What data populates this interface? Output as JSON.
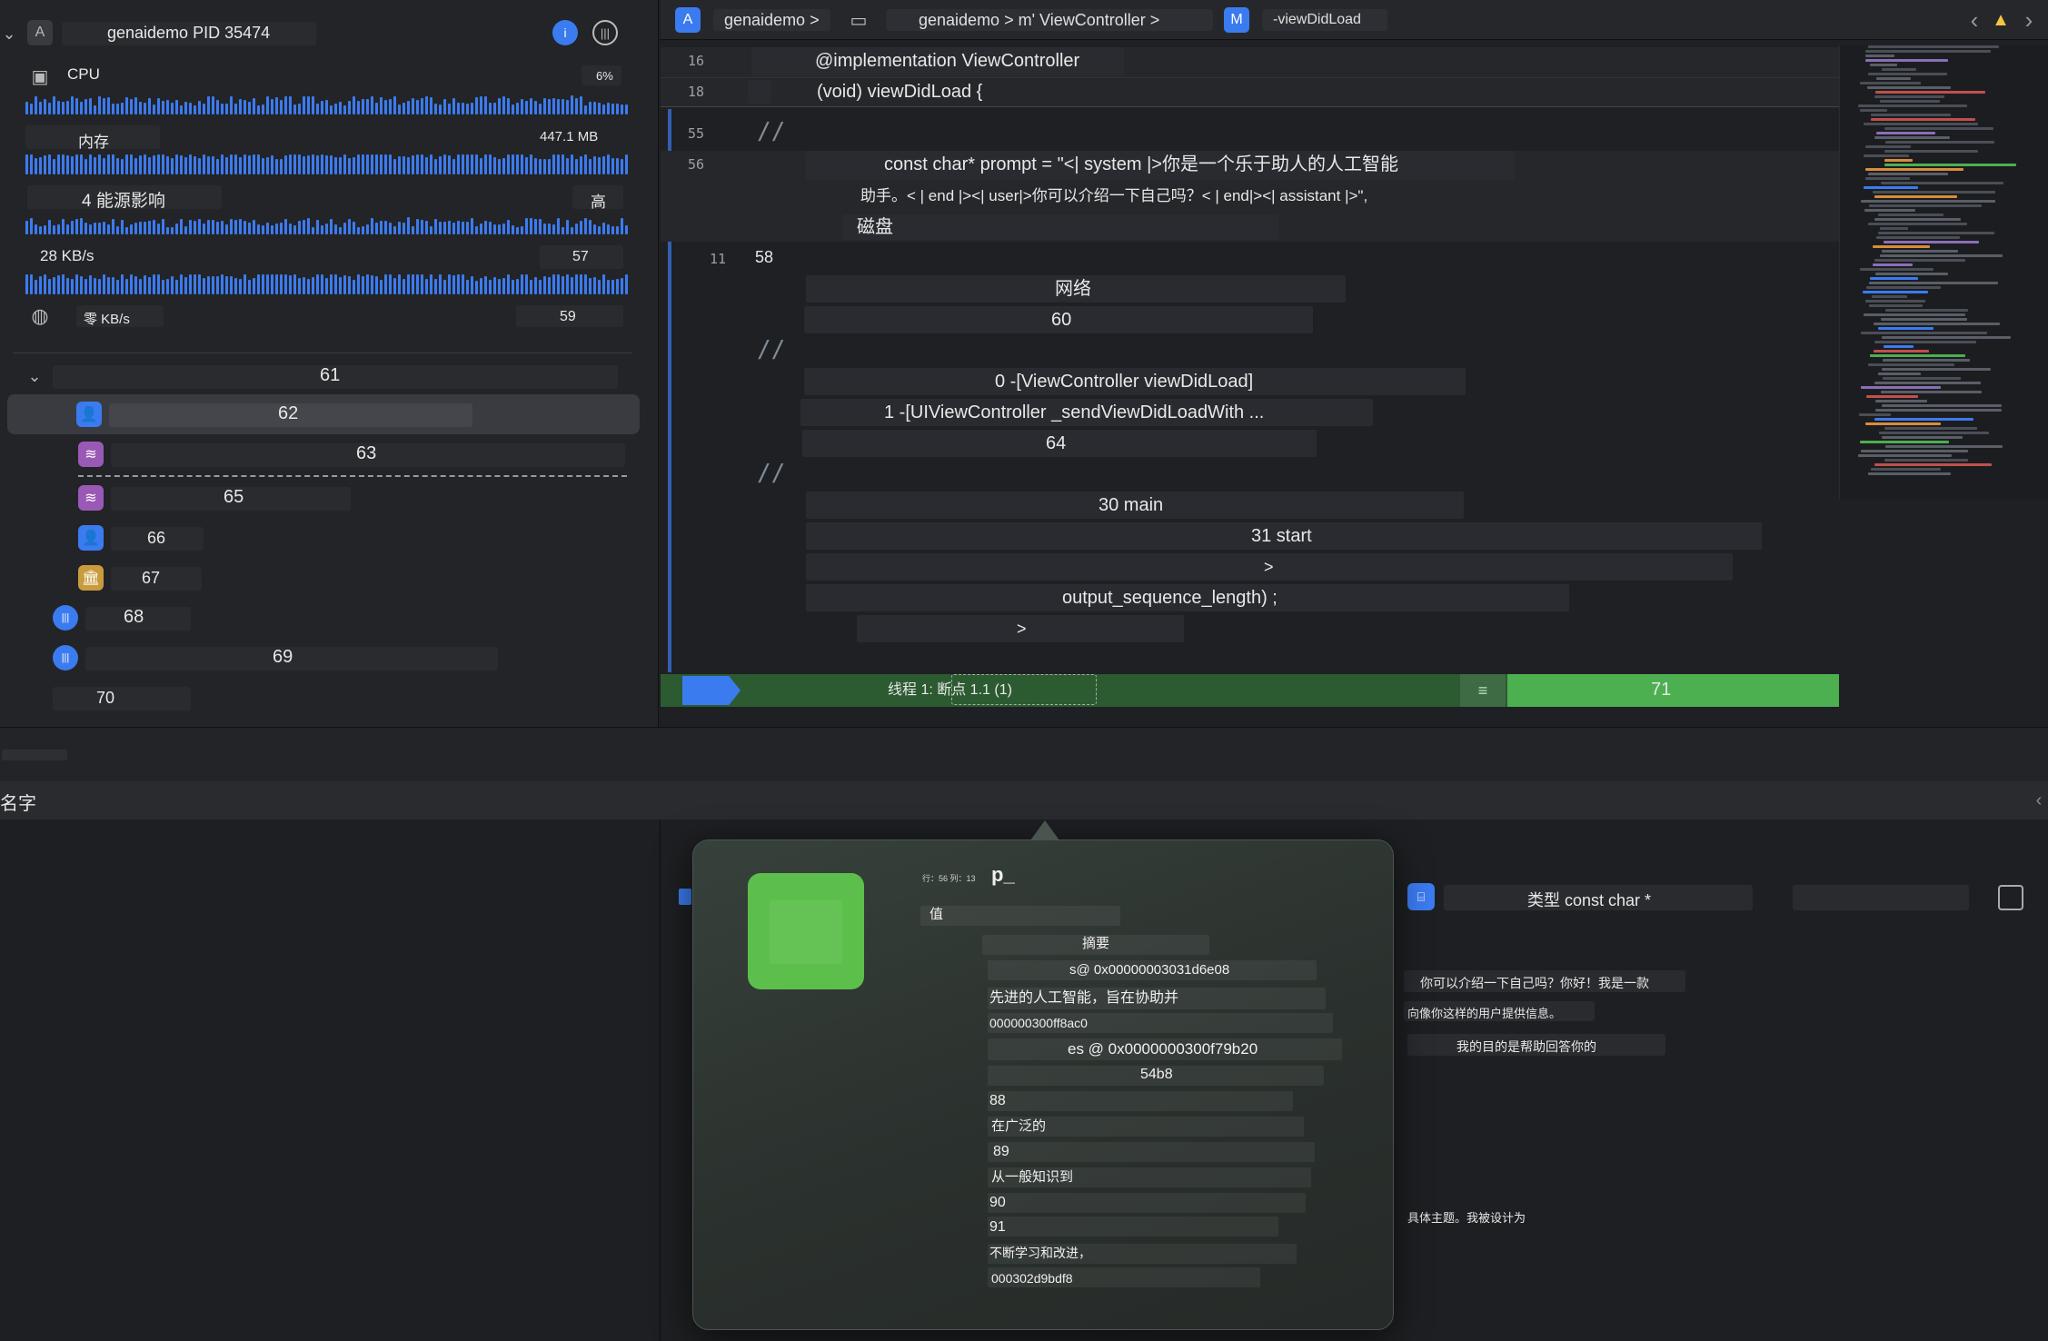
{
  "process": {
    "title": "genaidemo PID 35474"
  },
  "gauges": {
    "cpu_label": "CPU",
    "cpu_value": "6%",
    "memory_label": "内存",
    "memory_value": "447.1 MB",
    "energy_label": "4 能源影响",
    "energy_value": "高",
    "disk_value": "28 KB/s",
    "disk_side": "57",
    "network_value": "零 KB/s",
    "network_side": "59"
  },
  "threads": [
    {
      "label": "61"
    },
    {
      "label": "62"
    },
    {
      "label": "63"
    },
    {
      "label": "65"
    },
    {
      "label": "66"
    },
    {
      "label": "67"
    },
    {
      "label": "68"
    },
    {
      "label": "69"
    },
    {
      "label": "70"
    }
  ],
  "jumpbar": {
    "project": "genaidemo >",
    "path": "genaidemo > m' ViewController >",
    "method_badge": "M",
    "method": "-viewDidLoad"
  },
  "code": {
    "line16_no": "16",
    "line16": "@implementation ViewController",
    "line18_no": "18",
    "line18": "(void) viewDidLoad {",
    "line55_no": "55",
    "line56_no": "56",
    "prompt_a": "const char* prompt = \"<| system |>你是一个乐于助人的人工智能",
    "prompt_b": "助手。< | end |><| user|>你可以介绍一下自己吗？< | end|><| assistant |>\",",
    "disk": "磁盘",
    "line11_no": "11",
    "line58_no": "58",
    "network": "网络",
    "n60": "60",
    "frame0": "0 -[ViewController viewDidLoad]",
    "frame1": "1 -[UIViewController _sendViewDidLoadWith ...",
    "n64": "64",
    "frame30": "30 main",
    "frame31": "31 start",
    "gt1": ">",
    "output_len": "output_sequence_length) ;",
    "gt2": ">",
    "comment": "//"
  },
  "breakpoint": {
    "label": "线程 1: 断点 1.1 (1)",
    "count": "71"
  },
  "debug": {
    "filter_label": "名字"
  },
  "popover": {
    "var_name": "p_",
    "pos": "行：56 列：13",
    "value_label": "值",
    "summary_label": "摘要",
    "r1": "s@ 0x00000003031d6e08",
    "r2": "先进的人工智能，旨在协助并",
    "r3": "000000300ff8ac0",
    "r4": "es @ 0x0000000300f79b20",
    "r5": "54b8",
    "r6": "88",
    "r7": "在广泛的",
    "r8": "89",
    "r9": "从一般知识到",
    "r10": "90",
    "r11": "91",
    "r12": "不断学习和改进，",
    "r13": "000302d9bdf8"
  },
  "console": {
    "type_label": "类型 const char *",
    "c1": "你可以介绍一下自己吗？你好！我是一款",
    "c2": "向像你这样的用户提供信息。",
    "c3": "我的目的是帮助回答你的",
    "c4": "具体主题。我被设计为"
  },
  "colors": {
    "accent": "#3b7bf0",
    "breakpoint_green": "#4caf50",
    "popover_swatch": "#5cbf4b",
    "purple_icon": "#9b59b6",
    "gold_icon": "#c89b3c"
  }
}
